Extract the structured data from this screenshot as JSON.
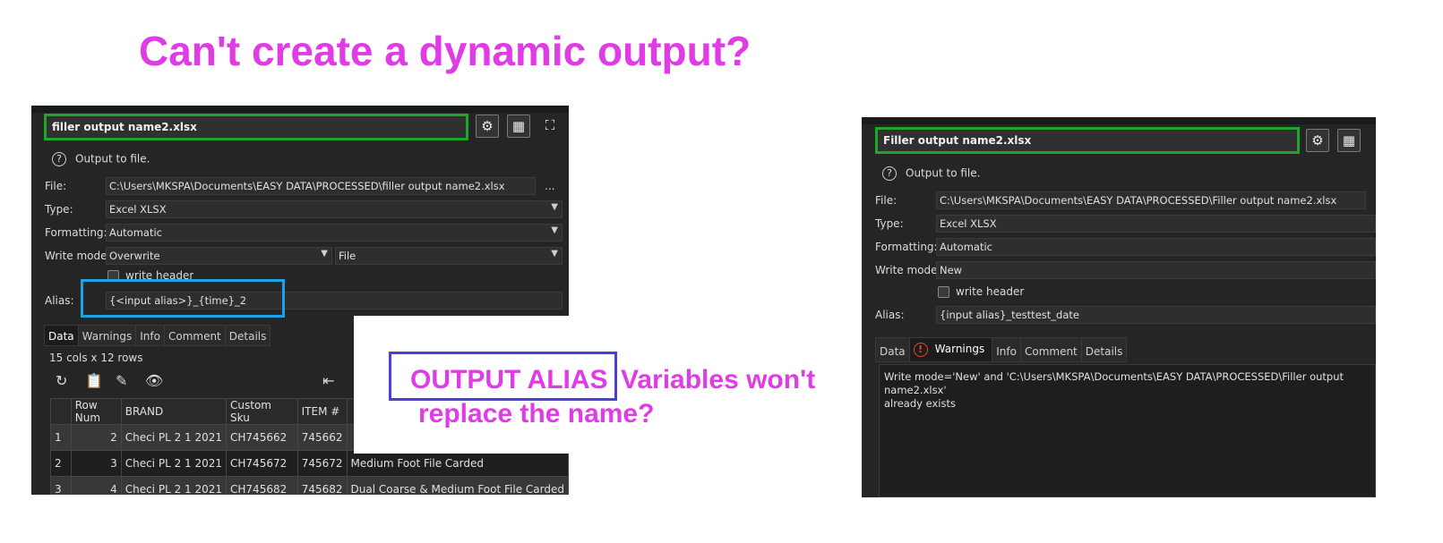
{
  "headline": "Can't create a dynamic output?",
  "colors": {
    "annotation": "#e03ce6",
    "green_frame": "#19a82a",
    "blue_frame": "#1aa3e8",
    "purple_frame": "#4b3fd6",
    "warning": "#e24a28"
  },
  "left_panel": {
    "title": "filler output name2.xlsx",
    "icons": [
      "gear-icon",
      "table-icon",
      "expand-icon"
    ],
    "help_text": "Output to file.",
    "file_label": "File:",
    "file_value": "C:\\Users\\MKSPA\\Documents\\EASY DATA\\PROCESSED\\filler output name2.xlsx",
    "browse_label": "...",
    "type_label": "Type:",
    "type_value": "Excel XLSX",
    "formatting_label": "Formatting:",
    "formatting_value": "Automatic",
    "write_mode_label": "Write mode:",
    "write_mode_value": "Overwrite",
    "write_target_value": "File",
    "write_header_label": "write header",
    "alias_label": "Alias:",
    "alias_value": "{<input alias>}_{time}_2",
    "tabs": [
      "Data",
      "Warnings",
      "Info",
      "Comment",
      "Details"
    ],
    "summary": "15 cols x 12 rows",
    "toolbar_icons": [
      "refresh-icon",
      "paste-icon",
      "edit-icon",
      "eye-icon",
      "first-page-icon"
    ],
    "columns": [
      "",
      "Row Num",
      "BRAND",
      "Custom Sku",
      "ITEM #",
      ""
    ],
    "rows": [
      [
        "1",
        "2",
        "Checi PL 2 1 2021",
        "CH745662",
        "745662",
        ""
      ],
      [
        "2",
        "3",
        "Checi PL 2 1 2021",
        "CH745672",
        "745672",
        "Medium Foot File Carded"
      ],
      [
        "3",
        "4",
        "Checi PL 2 1 2021",
        "CH745682",
        "745682",
        "Dual Coarse & Medium Foot File Carded"
      ]
    ]
  },
  "right_panel": {
    "title": "Filler output name2.xlsx",
    "icons": [
      "gear-icon",
      "table-icon"
    ],
    "help_text": "Output to file.",
    "file_label": "File:",
    "file_value": "C:\\Users\\MKSPA\\Documents\\EASY DATA\\PROCESSED\\Filler output name2.xlsx",
    "type_label": "Type:",
    "type_value": "Excel XLSX",
    "formatting_label": "Formatting:",
    "formatting_value": "Automatic",
    "write_mode_label": "Write mode:",
    "write_mode_value": "New",
    "write_header_label": "write header",
    "alias_label": "Alias:",
    "alias_value": "{input alias}_testtest_date",
    "tabs": [
      "Data",
      "Warnings",
      "Info",
      "Comment",
      "Details"
    ],
    "warning_message_line1": "Write mode='New' and 'C:\\Users\\MKSPA\\Documents\\EASY DATA\\PROCESSED\\Filler output name2.xlsx'",
    "warning_message_line2": "already exists"
  },
  "annotation": {
    "boxed_text": "OUTPUT ALIAS",
    "text_line1_rest": "Variables won't",
    "text_line2": "replace the name?"
  }
}
